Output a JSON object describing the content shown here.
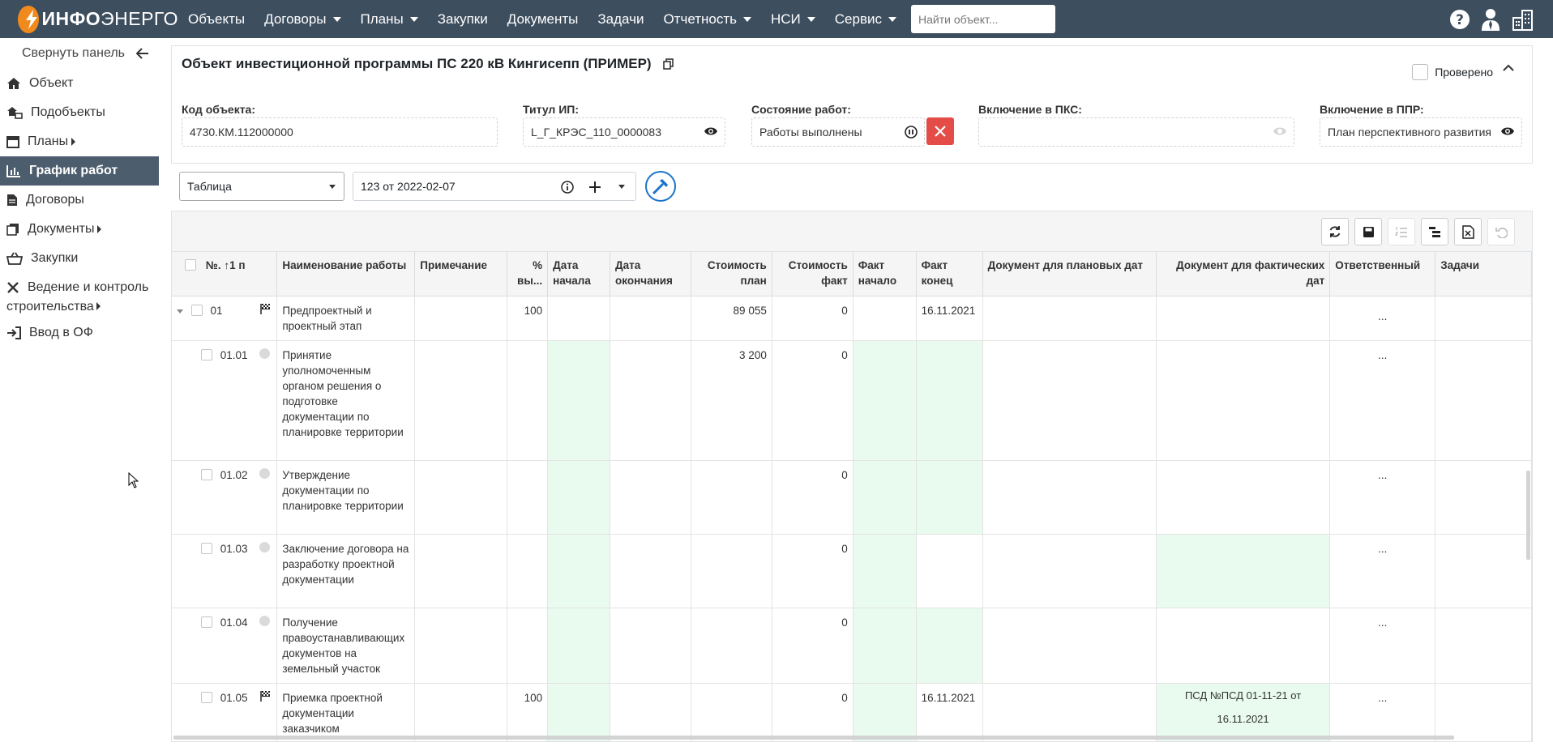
{
  "nav": {
    "logo_bold": "ИНФО",
    "logo_thin": "ЭНЕРГО",
    "items": [
      {
        "label": "Объекты",
        "dropdown": false
      },
      {
        "label": "Договоры",
        "dropdown": true
      },
      {
        "label": "Планы",
        "dropdown": true
      },
      {
        "label": "Закупки",
        "dropdown": false
      },
      {
        "label": "Документы",
        "dropdown": false
      },
      {
        "label": "Задачи",
        "dropdown": false
      },
      {
        "label": "Отчетность",
        "dropdown": true
      },
      {
        "label": "НСИ",
        "dropdown": true
      },
      {
        "label": "Сервис",
        "dropdown": true
      }
    ],
    "search_placeholder": "Найти объект..."
  },
  "sidebar": {
    "collapse_label": "Свернуть панель",
    "items": [
      {
        "label": "Объект",
        "icon": "home-icon"
      },
      {
        "label": "Подобъекты",
        "icon": "subobjects-icon"
      },
      {
        "label": "Планы",
        "icon": "calendar-icon",
        "submenu": true
      },
      {
        "label": "График работ",
        "icon": "chart-icon",
        "active": true
      },
      {
        "label": "Договоры",
        "icon": "document-icon"
      },
      {
        "label": "Документы",
        "icon": "documents-icon",
        "submenu": true
      },
      {
        "label": "Закупки",
        "icon": "basket-icon"
      },
      {
        "label_line1": "Ведение и контроль",
        "label_line2": "строительства",
        "icon": "tools-icon",
        "submenu": true
      },
      {
        "label": "Ввод в ОФ",
        "icon": "sign-in-icon"
      }
    ]
  },
  "object": {
    "title": "Объект инвестиционной программы ПС 220 кВ Кингисепп (ПРИМЕР)",
    "checked_label": "Проверено",
    "fields": {
      "code_label": "Код объекта:",
      "code_value": "4730.КМ.112000000",
      "title_label": "Титул ИП:",
      "title_value": "L_Г_КРЭС_110_0000083",
      "state_label": "Состояние работ:",
      "state_value": "Работы выполнены",
      "pks_label": "Включение в ПКС:",
      "pks_value": "",
      "ppr_label": "Включение в ППР:",
      "ppr_value": "План перспективного развития"
    }
  },
  "toolbar": {
    "view_select": "Таблица",
    "version": "123 от 2022-02-07"
  },
  "table": {
    "headers": {
      "num": "№. ↑1 п",
      "name": "Наименование работы",
      "note": "Примечание",
      "pct": "% вы...",
      "start": "Дата начала",
      "end": "Дата окончания",
      "cost_plan": "Стоимость план",
      "cost_fact": "Стоимость факт",
      "fact_start": "Факт начало",
      "fact_end": "Факт конец",
      "doc_plan": "Документ для плановых дат",
      "doc_fact": "Документ для фактических дат",
      "resp": "Ответственный",
      "tasks": "Задачи"
    },
    "rows": [
      {
        "num": "01",
        "name": "Предпроектный и проектный этап",
        "pct": "100",
        "cost_plan": "89 055",
        "cost_fact": "0",
        "fact_end": "16.11.2021",
        "doc_fact": "",
        "resp": "...",
        "icon": "flag-icon",
        "expand": true
      },
      {
        "num": "01.01",
        "name": "Принятие уполномоченным органом решения о подготовке документации по планировке территории",
        "pct": "",
        "cost_plan": "3 200",
        "cost_fact": "0",
        "fact_end": "",
        "doc_fact": "",
        "resp": "...",
        "icon": "clock-icon"
      },
      {
        "num": "01.02",
        "name": "Утверждение документации по планировке территории",
        "pct": "",
        "cost_plan": "",
        "cost_fact": "0",
        "fact_end": "",
        "doc_fact": "",
        "resp": "...",
        "icon": "clock-icon"
      },
      {
        "num": "01.03",
        "name": "Заключение договора на разработку проектной документации",
        "pct": "",
        "cost_plan": "",
        "cost_fact": "0",
        "fact_end": "",
        "doc_fact": "",
        "resp": "...",
        "icon": "clock-icon"
      },
      {
        "num": "01.04",
        "name": "Получение правоустанавливающих документов на земельный участок",
        "pct": "",
        "cost_plan": "",
        "cost_fact": "0",
        "fact_end": "",
        "doc_fact": "",
        "resp": "...",
        "icon": "clock-icon"
      },
      {
        "num": "01.05",
        "name": "Приемка проектной документации заказчиком",
        "pct": "100",
        "cost_plan": "",
        "cost_fact": "0",
        "fact_end": "16.11.2021",
        "doc_fact": "ПСД №ПСД 01-11-21 от 16.11.2021",
        "resp": "...",
        "icon": "flag-icon"
      }
    ]
  },
  "colors": {
    "nav_bg": "#3d4e5f",
    "active_bg": "#4c5d6e",
    "green_cell": "#e8fbee",
    "danger": "#e44c47",
    "accent": "#1b74c9",
    "logo": "#f08a1c"
  }
}
